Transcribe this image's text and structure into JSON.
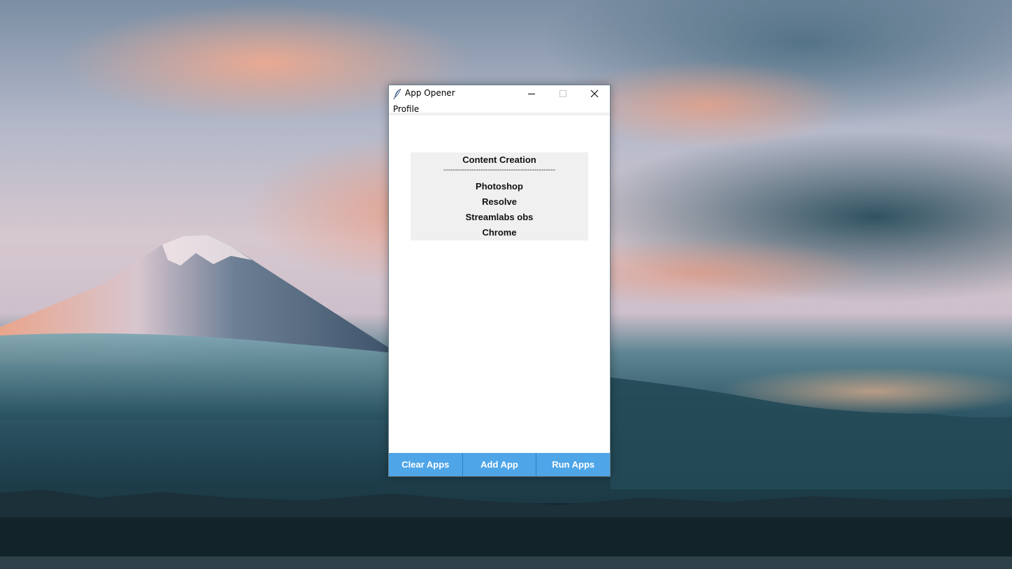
{
  "window": {
    "title": "App Opener",
    "menu": [
      "Profile"
    ]
  },
  "profile": {
    "name": "Content Creation",
    "separator": "------------------------------------------------",
    "apps": [
      "Photoshop",
      "Resolve",
      "Streamlabs obs",
      "Chrome"
    ]
  },
  "buttons": {
    "clear": "Clear Apps",
    "add": "Add App",
    "run": "Run Apps"
  },
  "colors": {
    "button_bg": "#4ea5e8",
    "panel_bg": "#f0f0f0"
  },
  "icons": {
    "app_icon": "feather-icon",
    "minimize": "minimize-icon",
    "maximize": "maximize-icon",
    "close": "close-icon"
  }
}
